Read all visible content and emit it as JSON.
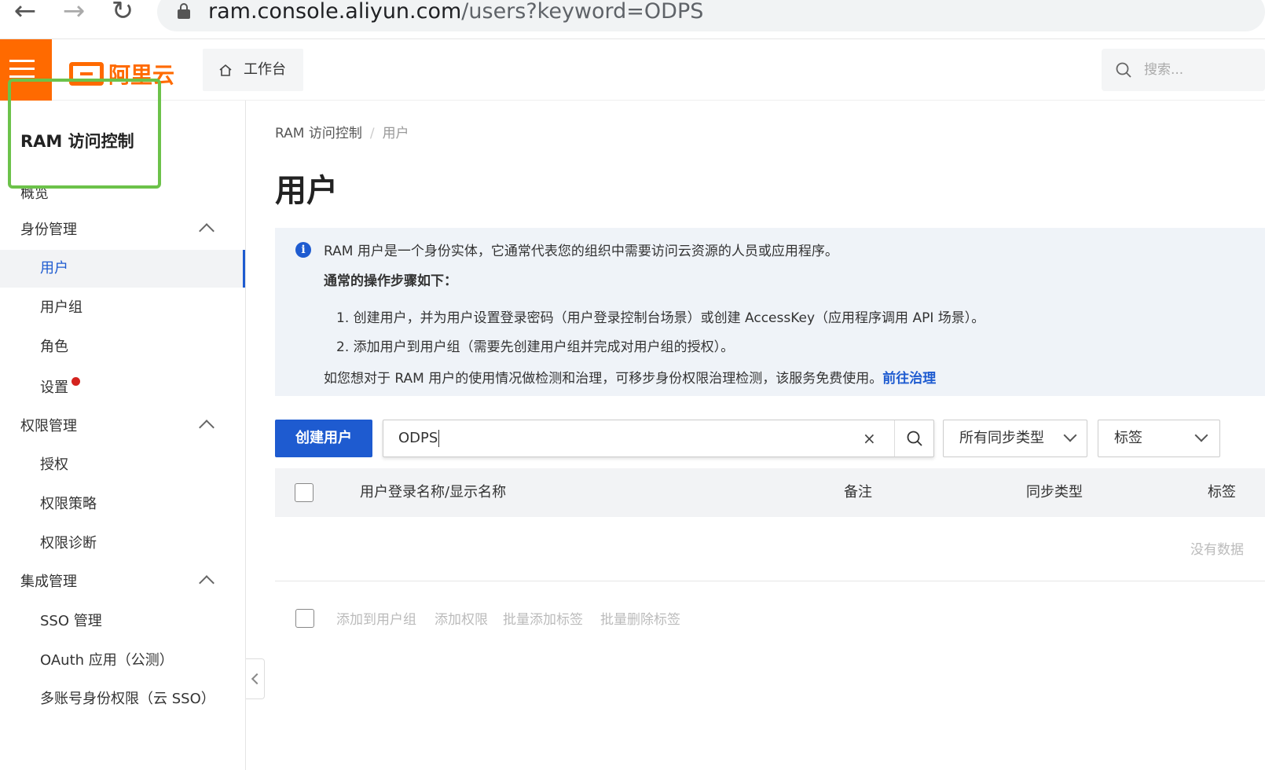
{
  "browser": {
    "url_domain": "ram.console.aliyun.com",
    "url_path": "/users?keyword=ODPS"
  },
  "topbar": {
    "logo_text": "阿里云",
    "workbench_label": "工作台",
    "search_placeholder": "搜索..."
  },
  "sidebar": {
    "title": "RAM 访问控制",
    "overview_label": "概览",
    "groups": [
      {
        "label": "身份管理",
        "items": [
          "用户",
          "用户组",
          "角色",
          "设置"
        ]
      },
      {
        "label": "权限管理",
        "items": [
          "授权",
          "权限策略",
          "权限诊断"
        ]
      },
      {
        "label": "集成管理",
        "items": [
          "SSO 管理",
          "OAuth 应用（公测）",
          "多账号身份权限（云 SSO）"
        ]
      }
    ],
    "active_item": "用户"
  },
  "breadcrumb": {
    "root": "RAM 访问控制",
    "current": "用户"
  },
  "page_title": "用户",
  "info": {
    "line1": "RAM 用户是一个身份实体，它通常代表您的组织中需要访问云资源的人员或应用程序。",
    "line2": "通常的操作步骤如下：",
    "step1": "1. 创建用户，并为用户设置登录密码（用户登录控制台场景）或创建 AccessKey（应用程序调用 API 场景）。",
    "step2": "2. 添加用户到用户组（需要先创建用户组并完成对用户组的授权）。",
    "line5": "如您想对于 RAM 用户的使用情况做检测和治理，可移步身份权限治理检测，该服务免费使用。",
    "link": "前往治理"
  },
  "toolbar": {
    "create_label": "创建用户",
    "search_value": "ODPS",
    "clear_glyph": "×",
    "sync_type_label": "所有同步类型",
    "tag_label": "标签"
  },
  "table": {
    "columns": [
      "用户登录名称/显示名称",
      "备注",
      "同步类型",
      "标签"
    ],
    "empty_text": "没有数据"
  },
  "batch_actions": [
    "添加到用户组",
    "添加权限",
    "批量添加标签",
    "批量删除标签"
  ],
  "colors": {
    "brand": "#ff6a00",
    "primary": "#1e5bd0",
    "annotation": "#6cc24a",
    "notice_dot": "#d4231e"
  }
}
